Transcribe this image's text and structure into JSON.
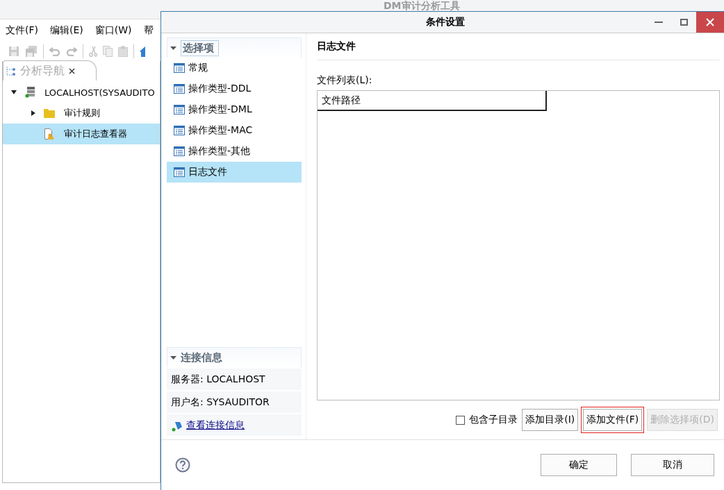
{
  "app": {
    "title": "DM审计分析工具",
    "menu": [
      "文件(F)",
      "编辑(E)",
      "窗口(W)",
      "帮"
    ],
    "nav_tab": {
      "label": "分析导航"
    },
    "tree": [
      {
        "label": "LOCALHOST(SYSAUDITO",
        "kind": "server",
        "expanded": true,
        "selected": false,
        "children": [
          {
            "label": "审计规则",
            "kind": "folder",
            "expanded": false,
            "selected": false
          },
          {
            "label": "审计日志查看器",
            "kind": "viewer",
            "selected": true
          }
        ]
      }
    ]
  },
  "dialog": {
    "title": "条件设置",
    "options": {
      "title": "选择项",
      "expanded": true,
      "items": [
        {
          "label": "常规",
          "selected": false
        },
        {
          "label": "操作类型-DDL",
          "selected": false
        },
        {
          "label": "操作类型-DML",
          "selected": false
        },
        {
          "label": "操作类型-MAC",
          "selected": false
        },
        {
          "label": "操作类型-其他",
          "selected": false
        },
        {
          "label": "日志文件",
          "selected": true
        }
      ]
    },
    "connection": {
      "title": "连接信息",
      "expanded": true,
      "server": "服务器: LOCALHOST",
      "user": "用户名: SYSAUDITOR",
      "link": "查看连接信息"
    },
    "page_title": "日志文件",
    "file_list": {
      "label": "文件列表(L):",
      "columns": [
        "文件路径"
      ]
    },
    "include_subdirs": {
      "label": "包含子目录",
      "checked": false
    },
    "buttons": [
      {
        "label": "添加目录(I)",
        "disabled": false,
        "highlighted": false
      },
      {
        "label": "添加文件(F)",
        "disabled": false,
        "highlighted": true
      },
      {
        "label": "删除选择项(D)",
        "disabled": true,
        "highlighted": false
      }
    ],
    "footer_buttons": [
      "确定",
      "取消"
    ]
  }
}
